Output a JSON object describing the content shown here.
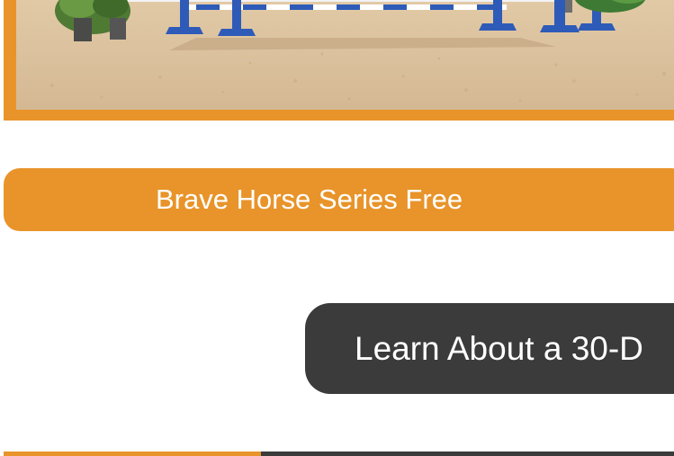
{
  "buttons": {
    "brave_horse": "Brave Horse Series Free",
    "learn_about": "Learn About a 30-D"
  },
  "colors": {
    "accent_orange": "#e8942a",
    "dark_gray": "#3b3b3b",
    "arena_sand": "#dcc3a0",
    "jump_blue": "#2e5bb8"
  }
}
